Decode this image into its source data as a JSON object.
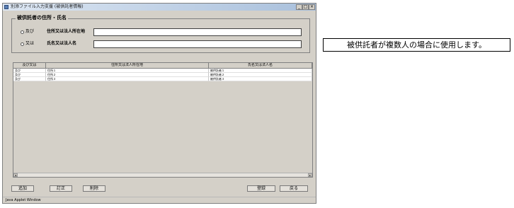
{
  "window": {
    "title": "別添ファイル入力支援 (被供託者情報)",
    "controls": {
      "minimize": "_",
      "maximize": "□",
      "close": "×"
    }
  },
  "group": {
    "title": "被供託者の住所・氏名",
    "radio_and": "及び",
    "radio_or": "又は",
    "address_label": "住所又は法人所在地",
    "name_label": "氏名又は法人名",
    "address_value": "",
    "name_value": ""
  },
  "table": {
    "headers": [
      "及び又は",
      "住所又は法人所在地",
      "氏名又は法人名"
    ],
    "rows": [
      [
        "及び",
        "住所１",
        "被供託者１"
      ],
      [
        "及び",
        "住所２",
        "被供託者２"
      ],
      [
        "及び",
        "住所３",
        "被供託者３"
      ]
    ],
    "scroll_left": "◂",
    "scroll_right": "▸"
  },
  "buttons": {
    "add": "追加",
    "edit": "訂正",
    "delete": "削除",
    "register": "登録",
    "back": "戻る"
  },
  "status": "Java Applet Window",
  "note": "被供託者が複数人の場合に使用します。",
  "colors": {
    "window_bg": "#d4d0c8",
    "title_gradient_end": "#a9c0dc"
  },
  "icons": {
    "app": "app-icon"
  }
}
